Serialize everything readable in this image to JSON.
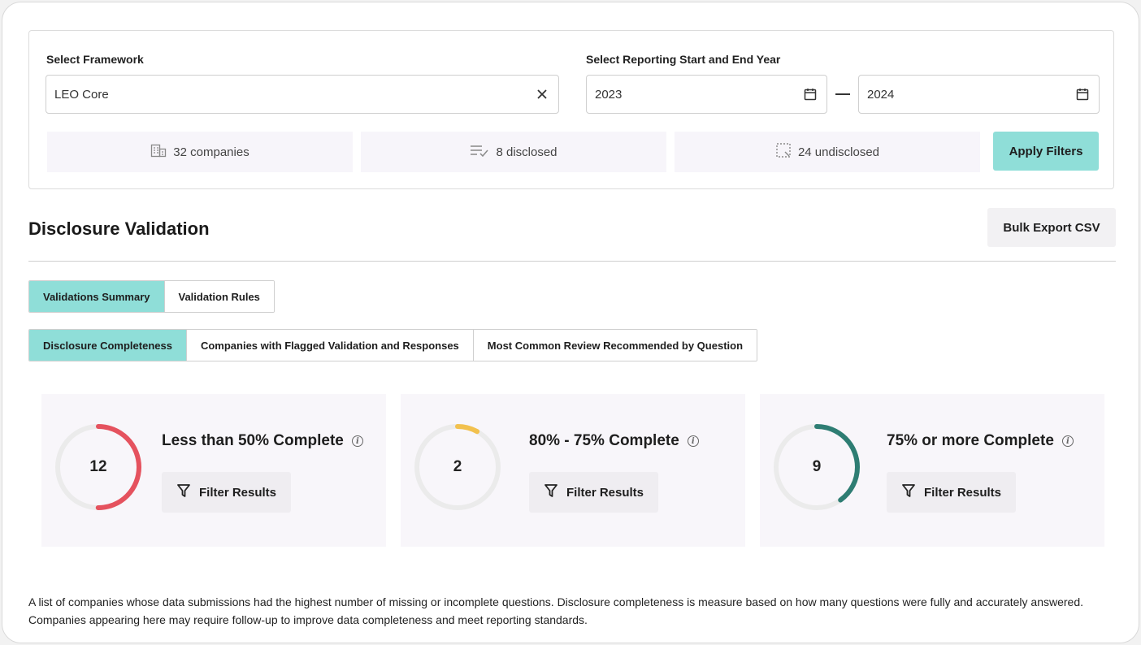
{
  "filters": {
    "framework_label": "Select Framework",
    "framework_value": "LEO Core",
    "year_label": "Select Reporting  Start and End Year",
    "start_year": "2023",
    "end_year": "2024",
    "apply_label": "Apply Filters"
  },
  "stats": {
    "companies": "32 companies",
    "disclosed": "8 disclosed",
    "undisclosed": "24 undisclosed"
  },
  "section": {
    "title": "Disclosure Validation",
    "export_label": "Bulk Export CSV"
  },
  "tabs_primary": [
    "Validations Summary",
    "Validation Rules"
  ],
  "tabs_secondary": [
    "Disclosure Completeness",
    "Companies with Flagged Validation and Responses",
    "Most Common Review Recommended by Question"
  ],
  "cards": [
    {
      "count": "12",
      "title": "Less than 50% Complete",
      "button": "Filter Results",
      "fraction": 0.5,
      "color": "#e5525e"
    },
    {
      "count": "2",
      "title": "80% - 75% Complete",
      "button": "Filter Results",
      "fraction": 0.08,
      "color": "#f2c14e"
    },
    {
      "count": "9",
      "title": "75% or more Complete",
      "button": "Filter Results",
      "fraction": 0.4,
      "color": "#2e7d73"
    }
  ],
  "colors": {
    "accent": "#8fded8",
    "track": "#ebebeb"
  },
  "description": "A list of companies whose data submissions had the highest number of missing or incomplete questions. Disclosure completeness is measure based on how many questions were fully and accurately answered. Companies appearing here may require follow-up to improve data completeness and meet reporting standards."
}
